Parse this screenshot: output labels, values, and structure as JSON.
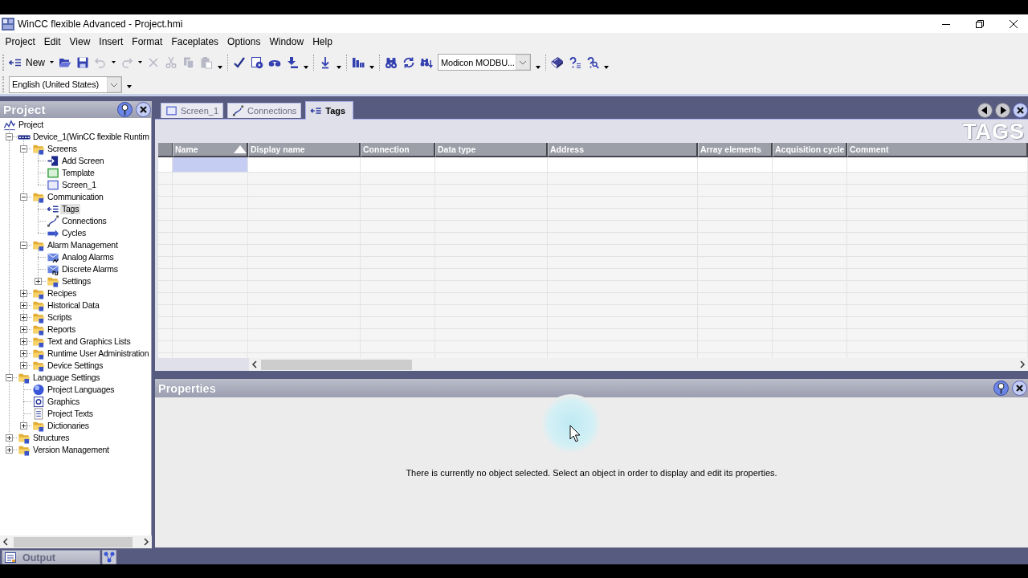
{
  "window": {
    "title": "WinCC flexible Advanced - Project.hmi"
  },
  "menu": [
    {
      "label": "Project"
    },
    {
      "label": "Edit"
    },
    {
      "label": "View"
    },
    {
      "label": "Insert"
    },
    {
      "label": "Format"
    },
    {
      "label": "Faceplates"
    },
    {
      "label": "Options"
    },
    {
      "label": "Window"
    },
    {
      "label": "Help"
    }
  ],
  "toolbars": [
    {
      "groups": [
        {
          "items": [
            {
              "kind": "new",
              "label": "New",
              "disabled": false,
              "dropdown": true
            },
            {
              "kind": "open",
              "disabled": false,
              "dropdown": false
            },
            {
              "kind": "save",
              "disabled": false,
              "dropdown": false
            },
            {
              "kind": "undo",
              "disabled": true,
              "dropdown": true
            },
            {
              "kind": "redo",
              "disabled": true,
              "dropdown": true
            },
            {
              "kind": "delete",
              "disabled": true,
              "dropdown": false
            },
            {
              "kind": "cut",
              "disabled": true,
              "dropdown": false
            },
            {
              "kind": "copy",
              "disabled": true,
              "dropdown": false
            },
            {
              "kind": "paste",
              "disabled": true,
              "dropdown": false
            }
          ]
        },
        {
          "items": [
            {
              "kind": "check",
              "disabled": false,
              "dropdown": false
            },
            {
              "kind": "generate",
              "disabled": false,
              "dropdown": false
            },
            {
              "kind": "simulate",
              "disabled": false,
              "dropdown": false
            },
            {
              "kind": "transfer",
              "disabled": false,
              "dropdown": false
            }
          ]
        },
        {
          "items": [
            {
              "kind": "download",
              "disabled": false,
              "dropdown": false
            }
          ]
        },
        {
          "items": [
            {
              "kind": "chart",
              "disabled": false,
              "dropdown": false
            }
          ]
        },
        {
          "items": [
            {
              "kind": "find",
              "disabled": false,
              "dropdown": false
            },
            {
              "kind": "replace",
              "disabled": false,
              "dropdown": false
            },
            {
              "kind": "findnext",
              "disabled": false,
              "dropdown": false
            },
            {
              "kind": "combobox",
              "value": "Modicon MODBU...",
              "disabled": false
            }
          ]
        },
        {
          "items": [
            {
              "kind": "help",
              "disabled": false,
              "dropdown": false
            },
            {
              "kind": "helplist",
              "disabled": false,
              "dropdown": false
            },
            {
              "kind": "helpsearch",
              "disabled": false,
              "dropdown": false
            }
          ]
        }
      ]
    },
    {
      "groups": [
        {
          "items": [
            {
              "kind": "combobox",
              "value": "English (United States)",
              "disabled": false
            }
          ]
        }
      ]
    }
  ],
  "project_panel": {
    "title": "Project",
    "tree": [
      {
        "label": "Project",
        "kind": "project",
        "selected": false,
        "children": [
          {
            "label": "Device_1(WinCC flexible Runtim",
            "kind": "device",
            "selected": false,
            "expanded": true,
            "children": [
              {
                "label": "Screens",
                "kind": "folder",
                "selected": false,
                "expanded": true,
                "children": [
                  {
                    "label": "Add Screen",
                    "kind": "addscreen",
                    "selected": false
                  },
                  {
                    "label": "Template",
                    "kind": "template",
                    "selected": false
                  },
                  {
                    "label": "Screen_1",
                    "kind": "screen",
                    "selected": false
                  }
                ]
              },
              {
                "label": "Communication",
                "kind": "folder",
                "selected": false,
                "expanded": true,
                "children": [
                  {
                    "label": "Tags",
                    "kind": "tags",
                    "selected": true
                  },
                  {
                    "label": "Connections",
                    "kind": "connections",
                    "selected": false
                  },
                  {
                    "label": "Cycles",
                    "kind": "cycles",
                    "selected": false
                  }
                ]
              },
              {
                "label": "Alarm Management",
                "kind": "folder",
                "selected": false,
                "expanded": true,
                "children": [
                  {
                    "label": "Analog Alarms",
                    "kind": "analogalarm",
                    "selected": false
                  },
                  {
                    "label": "Discrete Alarms",
                    "kind": "discretealarm",
                    "selected": false
                  },
                  {
                    "label": "Settings",
                    "kind": "folder",
                    "selected": false,
                    "expanded": false
                  }
                ]
              },
              {
                "label": "Recipes",
                "kind": "folder",
                "selected": false,
                "expanded": false
              },
              {
                "label": "Historical Data",
                "kind": "folder",
                "selected": false,
                "expanded": false
              },
              {
                "label": "Scripts",
                "kind": "folder",
                "selected": false,
                "expanded": false
              },
              {
                "label": "Reports",
                "kind": "folder",
                "selected": false,
                "expanded": false
              },
              {
                "label": "Text and Graphics Lists",
                "kind": "folder",
                "selected": false,
                "expanded": false
              },
              {
                "label": "Runtime User Administration",
                "kind": "folder",
                "selected": false,
                "expanded": false
              },
              {
                "label": "Device Settings",
                "kind": "folder",
                "selected": false,
                "expanded": false
              }
            ]
          },
          {
            "label": "Language Settings",
            "kind": "folder",
            "selected": false,
            "expanded": true,
            "children": [
              {
                "label": "Project Languages",
                "kind": "globe",
                "selected": false
              },
              {
                "label": "Graphics",
                "kind": "graphics",
                "selected": false
              },
              {
                "label": "Project Texts",
                "kind": "texts",
                "selected": false
              },
              {
                "label": "Dictionaries",
                "kind": "folder",
                "selected": false,
                "expanded": false
              }
            ]
          },
          {
            "label": "Structures",
            "kind": "folder",
            "selected": false,
            "expanded": false
          },
          {
            "label": "Version Management",
            "kind": "folder",
            "selected": false,
            "expanded": false
          }
        ]
      }
    ]
  },
  "editor": {
    "tabs": [
      {
        "label": "Screen_1",
        "kind": "screen",
        "selected": false
      },
      {
        "label": "Connections",
        "kind": "connections",
        "selected": false
      },
      {
        "label": "Tags",
        "kind": "tags",
        "selected": true
      }
    ],
    "title": "TAGS",
    "table": {
      "columns": [
        {
          "label": "Name",
          "sorted": true
        },
        {
          "label": "Display name",
          "sorted": false
        },
        {
          "label": "Connection",
          "sorted": false
        },
        {
          "label": "Data type",
          "sorted": false
        },
        {
          "label": "Address",
          "sorted": false
        },
        {
          "label": "Array elements",
          "sorted": false
        },
        {
          "label": "Acquisition cycle",
          "sorted": false
        },
        {
          "label": "Comment",
          "sorted": false
        }
      ],
      "insert_row": {
        "selected": true
      }
    }
  },
  "properties_panel": {
    "title": "Properties",
    "message": "There is currently no object selected. Select an object in order to display and edit its properties."
  },
  "output_panel": {
    "label": "Output"
  }
}
